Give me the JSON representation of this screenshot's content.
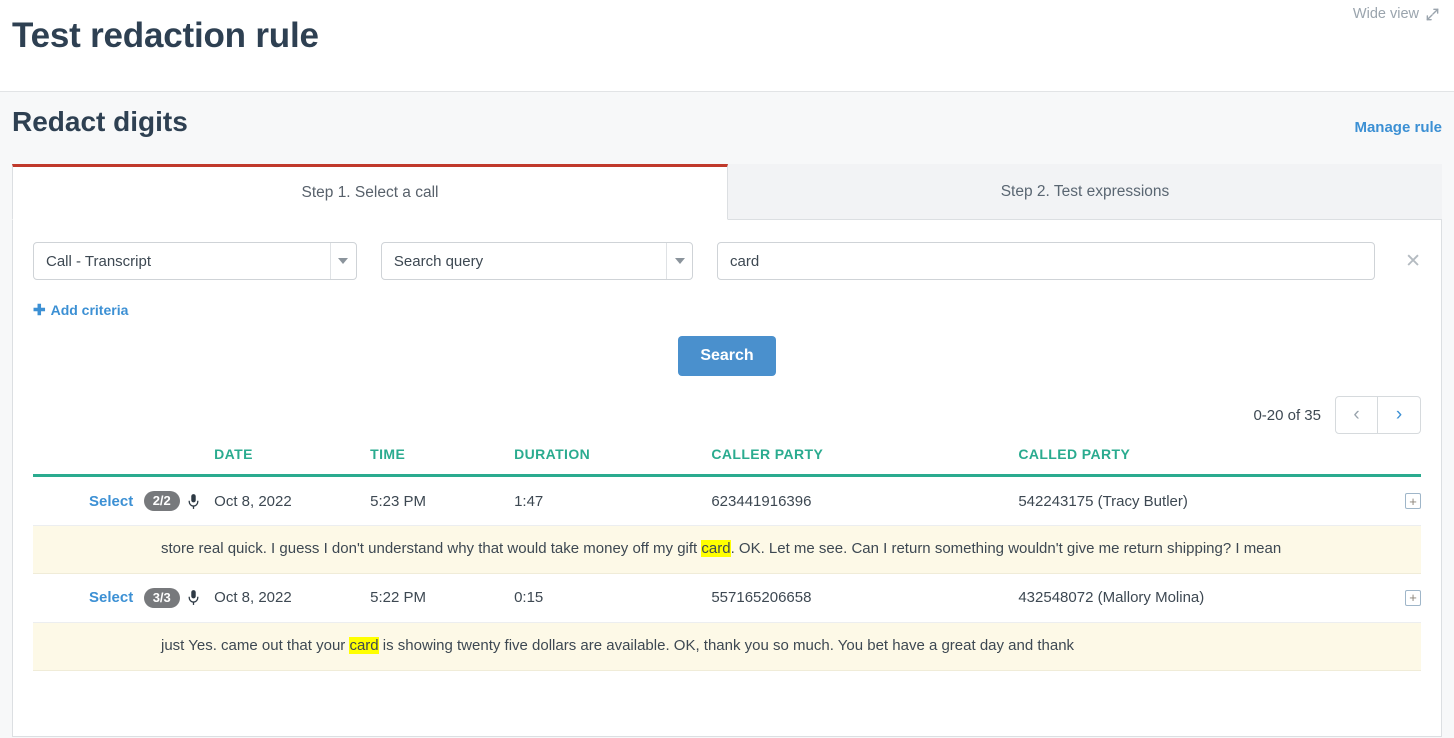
{
  "topbar": {
    "page_title": "Test redaction rule",
    "wide_view_label": "Wide view",
    "wide_view_icon": "expand-diagonal-icon"
  },
  "section": {
    "title": "Redact digits",
    "manage_rule_label": "Manage rule"
  },
  "tabs": [
    {
      "label": "Step 1. Select a call",
      "active": true
    },
    {
      "label": "Step 2. Test expressions",
      "active": false
    }
  ],
  "criteria": {
    "field_select": {
      "value": "Call - Transcript",
      "caret_icon": "chevron-down-icon"
    },
    "operator_select": {
      "value": "Search query",
      "caret_icon": "chevron-down-icon"
    },
    "query_input": {
      "value": "card",
      "placeholder": ""
    },
    "clear_icon": "close-icon",
    "add_criteria_label": "Add criteria",
    "add_criteria_icon": "plus-icon"
  },
  "search_button_label": "Search",
  "pagination": {
    "range_label": "0-20 of 35",
    "prev_icon": "chevron-left-icon",
    "next_icon": "chevron-right-icon"
  },
  "table": {
    "columns": [
      "",
      "",
      "DATE",
      "TIME",
      "DURATION",
      "CALLER PARTY",
      "CALLED PARTY",
      ""
    ],
    "rows": [
      {
        "select_label": "Select",
        "badge": "2/2",
        "badge_icon": "microphone-icon",
        "date": "Oct 8, 2022",
        "time": "5:23 PM",
        "duration": "1:47",
        "caller_party": "623441916396",
        "called_party": "542243175 (Tracy Butler)",
        "expand_icon": "plus-box-icon",
        "transcript": {
          "before": "store real quick. I guess I don't understand why that would take money off my gift ",
          "highlight": "card",
          "after": ". OK. Let me see. Can I return something wouldn't give me return shipping? I mean"
        }
      },
      {
        "select_label": "Select",
        "badge": "3/3",
        "badge_icon": "microphone-icon",
        "date": "Oct 8, 2022",
        "time": "5:22 PM",
        "duration": "0:15",
        "caller_party": "557165206658",
        "called_party": "432548072 (Mallory Molina)",
        "expand_icon": "plus-box-icon",
        "transcript": {
          "before": "just Yes. came out that your ",
          "highlight": "card",
          "after": " is showing twenty five dollars are available. OK, thank you so much. You bet have a great day and thank"
        }
      }
    ]
  },
  "colors": {
    "accent_blue": "#3c90d4",
    "button_blue": "#4a90cd",
    "tab_active_border": "#c0392b",
    "table_header_teal": "#2aab8f",
    "highlight_yellow": "#ffff00",
    "transcript_bg": "#fdf9e7",
    "title_navy": "#2e4052"
  }
}
